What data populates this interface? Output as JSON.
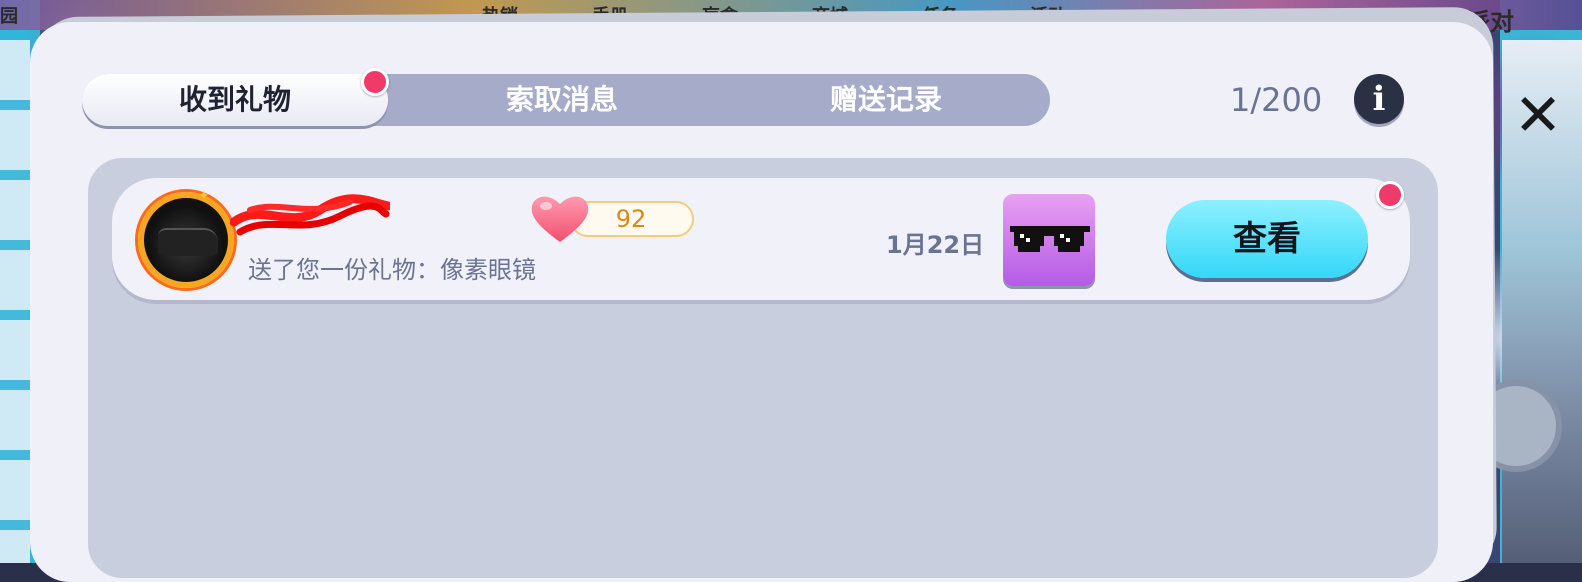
{
  "background_nav": [
    "热销",
    "手册",
    "盲盒",
    "商城",
    "任务",
    "活动"
  ],
  "background_corner_left": "园",
  "background_corner_right": "巅峰派对",
  "close_icon_glyph": "✕",
  "tabs": [
    {
      "label": "收到礼物",
      "active": true,
      "has_badge": true
    },
    {
      "label": "索取消息",
      "active": false,
      "has_badge": false
    },
    {
      "label": "赠送记录",
      "active": false,
      "has_badge": false
    }
  ],
  "counter": "1/200",
  "info_icon_glyph": "i",
  "gift_rows": [
    {
      "sender_name": "",
      "message": "送了您一份礼物：像素眼镜",
      "likes": "92",
      "date": "1月22日",
      "gift_icon": "pixel-sunglasses-icon",
      "action_label": "查看",
      "has_badge": true
    }
  ],
  "colors": {
    "badge": "#f03a6a",
    "view_button": "#33d7f7",
    "tab_bar": "#a5abc9",
    "gift_tile": "#b45be6"
  }
}
